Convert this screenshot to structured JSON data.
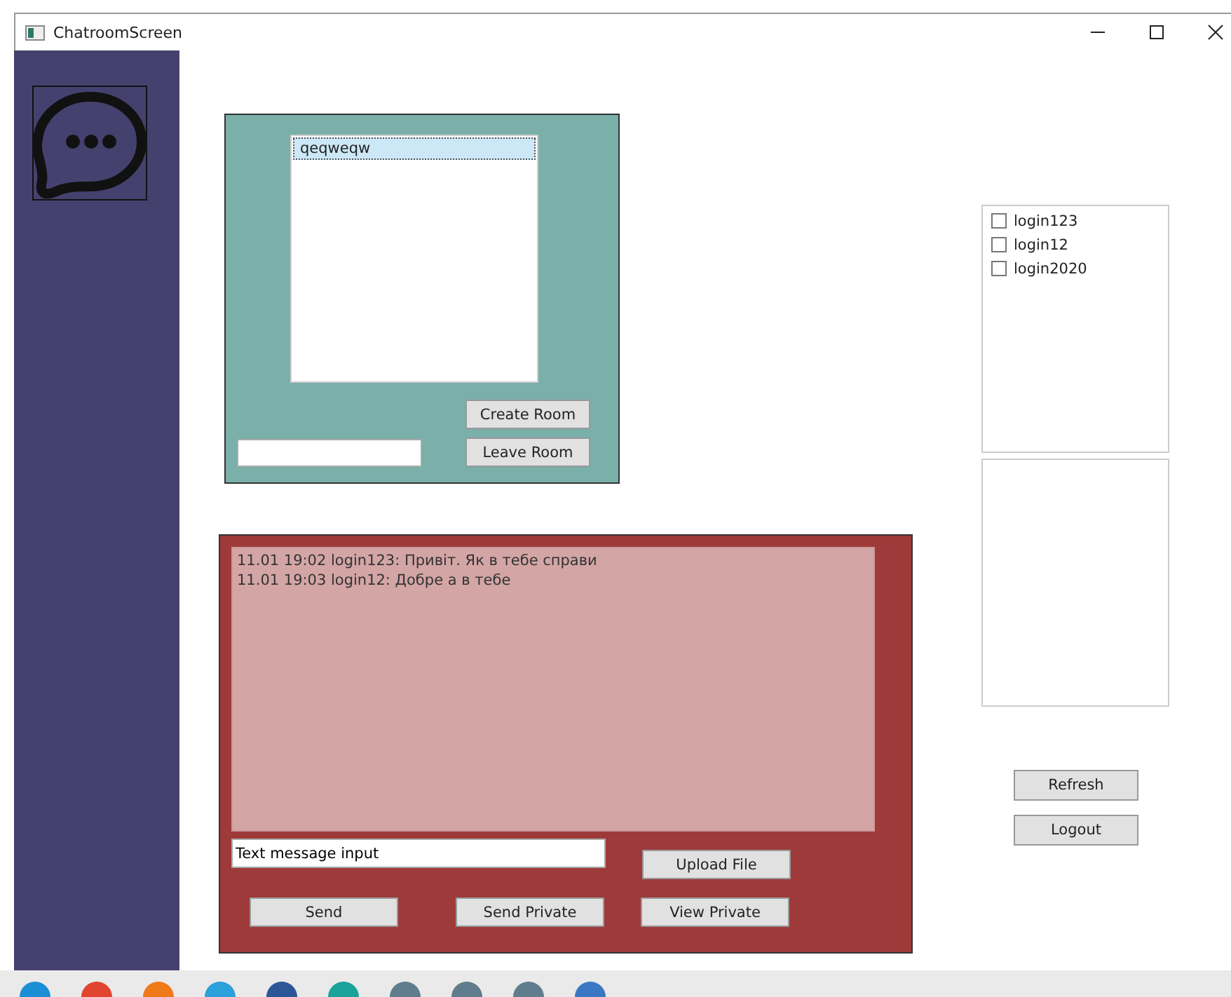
{
  "window": {
    "title": "ChatroomScreen"
  },
  "rooms": {
    "items": [
      {
        "label": "qeqweqw",
        "selected": true
      }
    ],
    "buttons": [
      "Create Room",
      "Leave Room"
    ]
  },
  "chat": {
    "messages": [
      "11.01 19:02 login123: Привіт. Як в тебе справи",
      "11.01 19:03 login12: Добре а в тебе"
    ],
    "message_input": {
      "value": "Text message input"
    },
    "upload_button": "Upload File",
    "buttons": [
      "Send",
      "Send Private",
      "View Private"
    ]
  },
  "users": [
    {
      "name": "login123",
      "checked": false
    },
    {
      "name": "login12",
      "checked": false
    },
    {
      "name": "login2020",
      "checked": false
    }
  ],
  "side_buttons": [
    "Refresh",
    "Logout"
  ],
  "taskbar": [
    {
      "color": "#1b8fd6"
    },
    {
      "color": "#e0452f"
    },
    {
      "color": "#f07a1a"
    },
    {
      "color": "#2aa1db"
    },
    {
      "color": "#2b5797"
    },
    {
      "color": "#1aa39a"
    },
    {
      "color": "#5f7d8c"
    },
    {
      "color": "#5f7d8c"
    },
    {
      "color": "#5f7d8c"
    },
    {
      "color": "#3b78c4"
    }
  ]
}
